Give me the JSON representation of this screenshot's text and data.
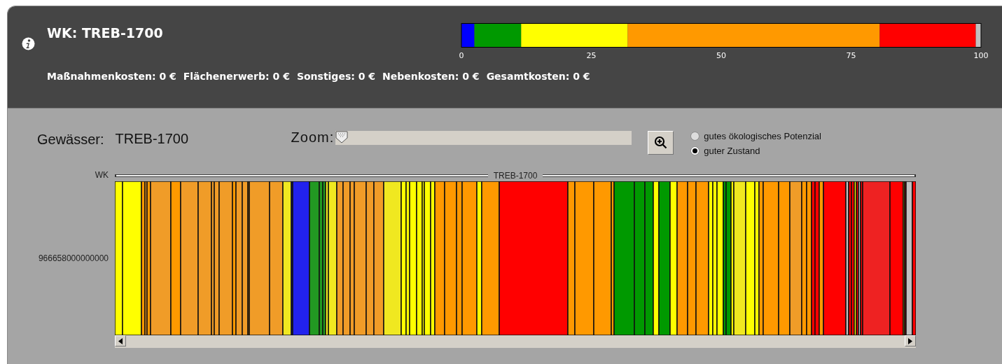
{
  "header": {
    "title": "WK: TREB-1700",
    "costs": [
      "Maßnahmenkosten: 0 €",
      "Flächenerwerb: 0 €",
      "Sonstiges: 0 €",
      "Nebenkosten: 0 €",
      "Gesamtkosten: 0 €"
    ],
    "legend": {
      "chart_data": {
        "type": "bar",
        "stacked": true,
        "orientation": "horizontal",
        "xlim": [
          0,
          100
        ],
        "xticks": [
          0,
          25,
          50,
          75,
          100
        ],
        "series": [
          {
            "color": "#0000ff",
            "values": [
              2.5
            ]
          },
          {
            "color": "#009900",
            "values": [
              9
            ]
          },
          {
            "color": "#ffff00",
            "values": [
              20.5
            ]
          },
          {
            "color": "#ff9900",
            "values": [
              48.5
            ]
          },
          {
            "color": "#ff0000",
            "values": [
              18.5
            ]
          },
          {
            "color": "#c0c0c0",
            "values": [
              1
            ]
          }
        ]
      }
    }
  },
  "water_body": {
    "label": "Gewässer:",
    "value": "TREB-1700"
  },
  "zoom": {
    "label": "Zoom:",
    "level": 0
  },
  "target_options": [
    {
      "label": "gutes ökologisches Potenzial",
      "selected": false
    },
    {
      "label": "guter Zustand",
      "selected": true
    }
  ],
  "strip": {
    "row_header": "WK",
    "range_label": "TREB-1700",
    "row_label": "966658000000000"
  }
}
